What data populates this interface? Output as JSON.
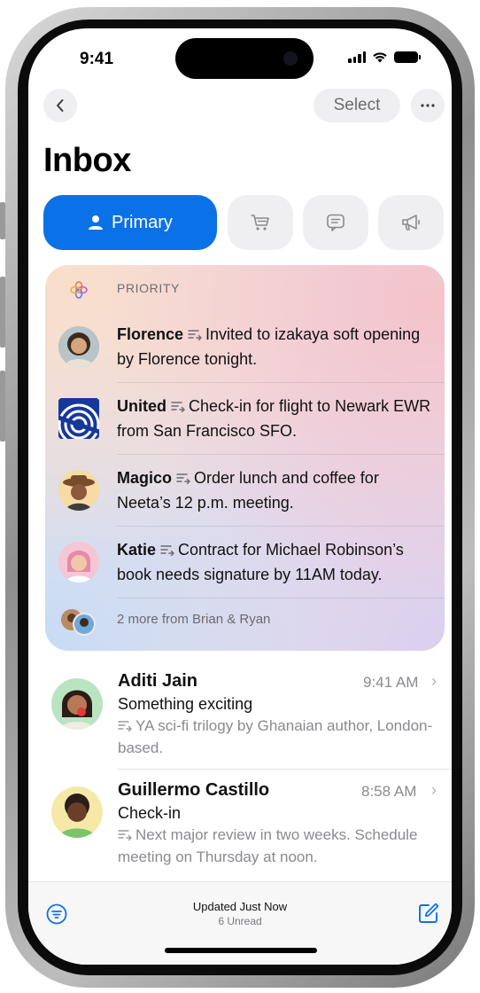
{
  "status": {
    "time": "9:41"
  },
  "nav": {
    "back_icon": "chevron-left-icon",
    "select_label": "Select",
    "more_icon": "ellipsis-icon"
  },
  "title": "Inbox",
  "tabs": [
    {
      "label": "Primary",
      "icon": "person-icon",
      "selected": true
    },
    {
      "label": "",
      "icon": "cart-icon"
    },
    {
      "label": "",
      "icon": "message-icon"
    },
    {
      "label": "",
      "icon": "megaphone-icon"
    }
  ],
  "priority": {
    "header": "PRIORITY",
    "items": [
      {
        "sender": "Florence",
        "summary": "Invited to izakaya soft opening by Florence tonight."
      },
      {
        "sender": "United",
        "summary": "Check-in for flight to Newark EWR from San Francisco SFO."
      },
      {
        "sender": "Magico",
        "summary": "Order lunch and coffee for Neeta’s 12 p.m. meeting."
      },
      {
        "sender": "Katie",
        "summary": "Contract for Michael Robinson’s book needs signature by 11AM today."
      }
    ],
    "more": "2 more from Brian & Ryan"
  },
  "mails": [
    {
      "sender": "Aditi Jain",
      "time": "9:41 AM",
      "subject": "Something exciting",
      "preview": "YA sci-fi trilogy by Ghanaian author, London-based."
    },
    {
      "sender": "Guillermo Castillo",
      "time": "8:58 AM",
      "subject": "Check-in",
      "preview": "Next major review in two weeks. Schedule meeting on Thursday at noon."
    }
  ],
  "footer": {
    "updated": "Updated Just Now",
    "unread": "6 Unread"
  },
  "colors": {
    "accent": "#0b71e6",
    "background": "#ffffff",
    "secondary_text": "#8a8a8f"
  }
}
